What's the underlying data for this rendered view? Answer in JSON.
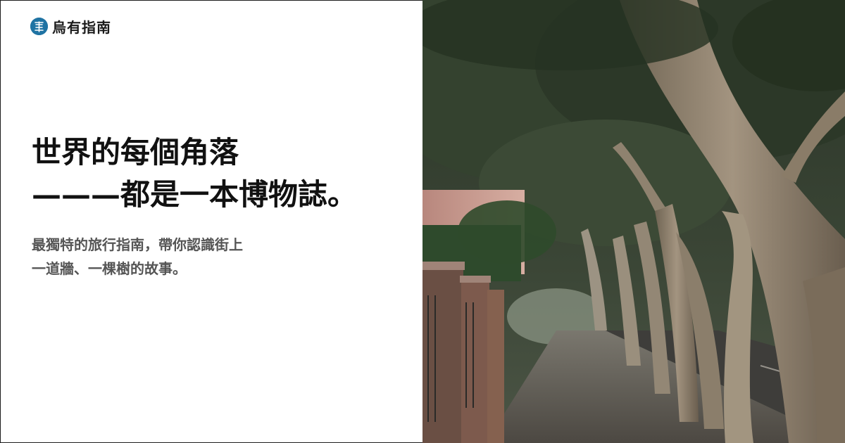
{
  "brand": {
    "name": "烏有指南",
    "logo_icon": "brand-seal-icon",
    "logo_color": "#1f73a3"
  },
  "hero": {
    "headline_line1": "世界的每個角落",
    "headline_line2": "———都是一本博物誌。",
    "subtitle_line1": "最獨特的旅行指南，帶你認識街上",
    "subtitle_line2": "一道牆、一棵樹的故事。"
  },
  "photo": {
    "subject": "tree-lined-street-photo",
    "colors": {
      "canopy": "#2f3a2b",
      "trunk": "#9a8b76",
      "wall": "#c99e93",
      "pavement": "#5e5a52"
    }
  }
}
